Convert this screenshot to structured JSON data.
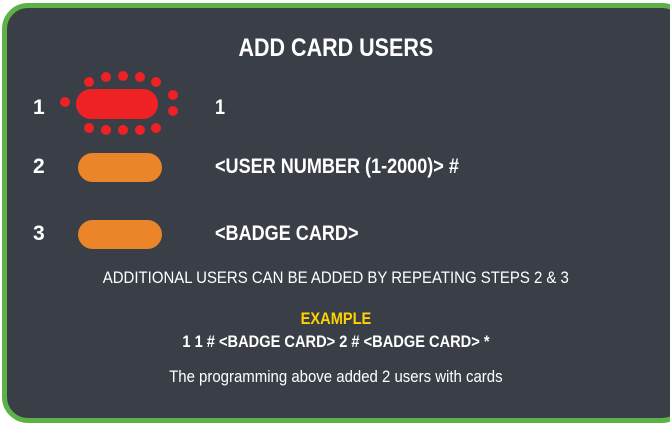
{
  "title": "ADD CARD USERS",
  "steps": [
    {
      "number": "1",
      "text": "1",
      "indicator": "red-flashing-led"
    },
    {
      "number": "2",
      "text": "<USER NUMBER (1-2000)> #",
      "indicator": "amber-led"
    },
    {
      "number": "3",
      "text": "<BADGE CARD>",
      "indicator": "amber-led"
    }
  ],
  "note": "ADDITIONAL USERS CAN BE ADDED BY REPEATING STEPS 2 & 3",
  "example": {
    "label": "EXAMPLE",
    "sequence": "1 1 # <BADGE CARD> 2 # <BADGE CARD> *",
    "description": "The programming above added 2 users with cards"
  },
  "colors": {
    "panel_background": "#3a3f47",
    "border": "#5cb247",
    "led_red": "#ee2124",
    "led_amber": "#ea8629",
    "example_label": "#ffd200",
    "text": "#ffffff"
  }
}
